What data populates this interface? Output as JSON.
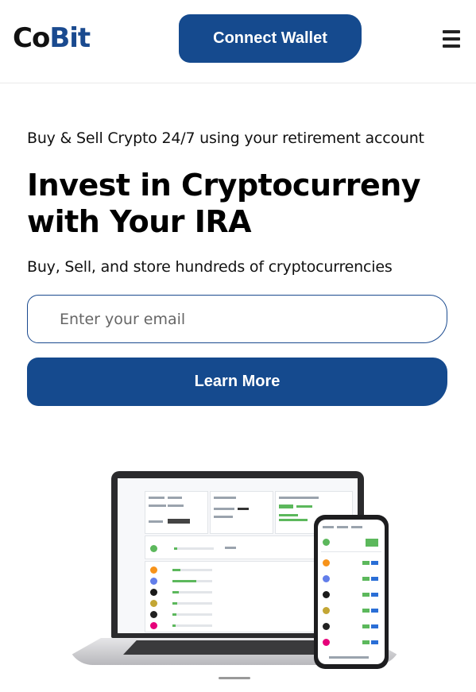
{
  "header": {
    "logo_part1": "Co",
    "logo_part2": "Bit",
    "connect_label": "Connect Wallet",
    "brand_color": "#154a8e"
  },
  "hero": {
    "tagline": "Buy & Sell Crypto 24/7 using your retirement account",
    "headline_line1": "Invest in Cryptocurreny",
    "headline_line2": "with Your IRA",
    "subline": "Buy, Sell, and store hundreds of cryptocurrencies",
    "email_placeholder": "Enter your email",
    "learn_more_label": "Learn More"
  },
  "illustration": {
    "icon": "laptop-and-phone-dashboard",
    "coin_colors": [
      "#f7931a",
      "#627eea",
      "#1a1a1a",
      "#c3a634",
      "#222222",
      "#e6007a"
    ]
  }
}
